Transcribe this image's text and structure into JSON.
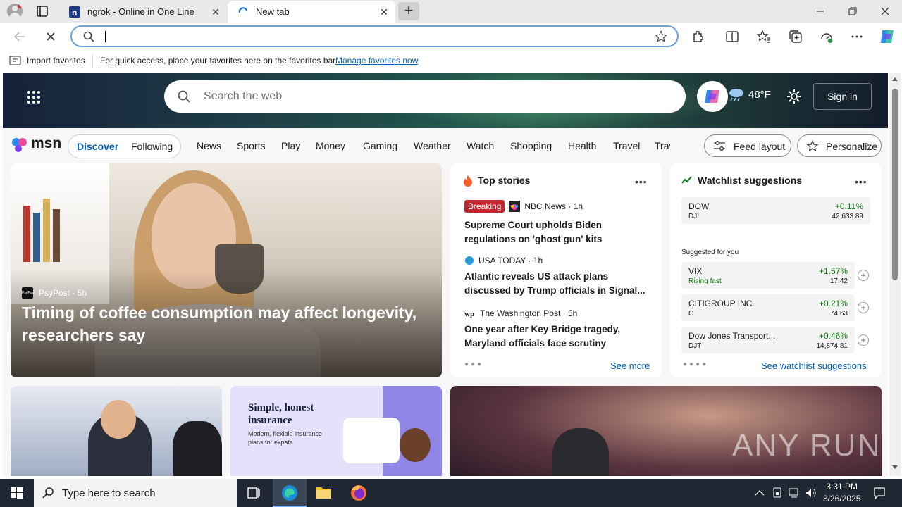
{
  "tabs": [
    {
      "title": "ngrok - Online in One Line",
      "favicon": "ngrok-icon"
    },
    {
      "title": "New tab",
      "favicon": "loading-icon"
    }
  ],
  "favorites_bar": {
    "import_label": "Import favorites",
    "message": "For quick access, place your favorites here on the favorites bar.",
    "manage_link": "Manage favorites now"
  },
  "msn": {
    "search_placeholder": "Search the web",
    "weather": "48°F",
    "signin": "Sign in",
    "logo": "msn",
    "pill": [
      "Discover",
      "Following"
    ],
    "categories": [
      "News",
      "Sports",
      "Play",
      "Money",
      "Gaming",
      "Weather",
      "Watch",
      "Shopping",
      "Health",
      "Travel",
      "Trav"
    ],
    "feed_layout": "Feed layout",
    "personalize": "Personalize"
  },
  "lead_story": {
    "source": "PsyPost",
    "age": "5h",
    "source_line": "PsyPost · 5h",
    "title": "Timing of coffee consumption may affect longevity, researchers say",
    "badge_text": "PsyPost"
  },
  "top_stories": {
    "heading": "Top stories",
    "items": [
      {
        "badge": "Breaking",
        "source": "NBC News · 1h",
        "title": "Supreme Court upholds Biden regulations on 'ghost gun' kits"
      },
      {
        "source": "USA TODAY · 1h",
        "title": "Atlantic reveals US attack plans discussed by Trump officials in Signal..."
      },
      {
        "source": "The Washington Post · 5h",
        "title": "One year after Key Bridge tragedy, Maryland officials face scrutiny"
      }
    ],
    "see_more": "See more"
  },
  "watchlist": {
    "heading": "Watchlist suggestions",
    "dow": {
      "name": "DOW",
      "symbol": "DJI",
      "change": "+0.11%",
      "price": "42,633.89"
    },
    "suggested_label": "Suggested for you",
    "items": [
      {
        "name": "VIX",
        "symbol": "Rising fast",
        "change": "+1.57%",
        "price": "17.42"
      },
      {
        "name": "CITIGROUP INC.",
        "symbol": "C",
        "change": "+0.21%",
        "price": "74.63"
      },
      {
        "name": "Dow Jones Transport...",
        "symbol": "DJT",
        "change": "+0.46%",
        "price": "14,874.81"
      }
    ],
    "see_all": "See watchlist suggestions"
  },
  "ad": {
    "headline": "Simple, honest insurance",
    "sub": "Modern, flexible insurance plans for expats"
  },
  "watermark": "ANY RUN",
  "taskbar": {
    "search_placeholder": "Type here to search",
    "time": "3:31 PM",
    "date": "3/26/2025"
  },
  "colors": {
    "accent": "#005fb8",
    "positive": "#0e7a0d",
    "breaking": "#c4262e"
  }
}
